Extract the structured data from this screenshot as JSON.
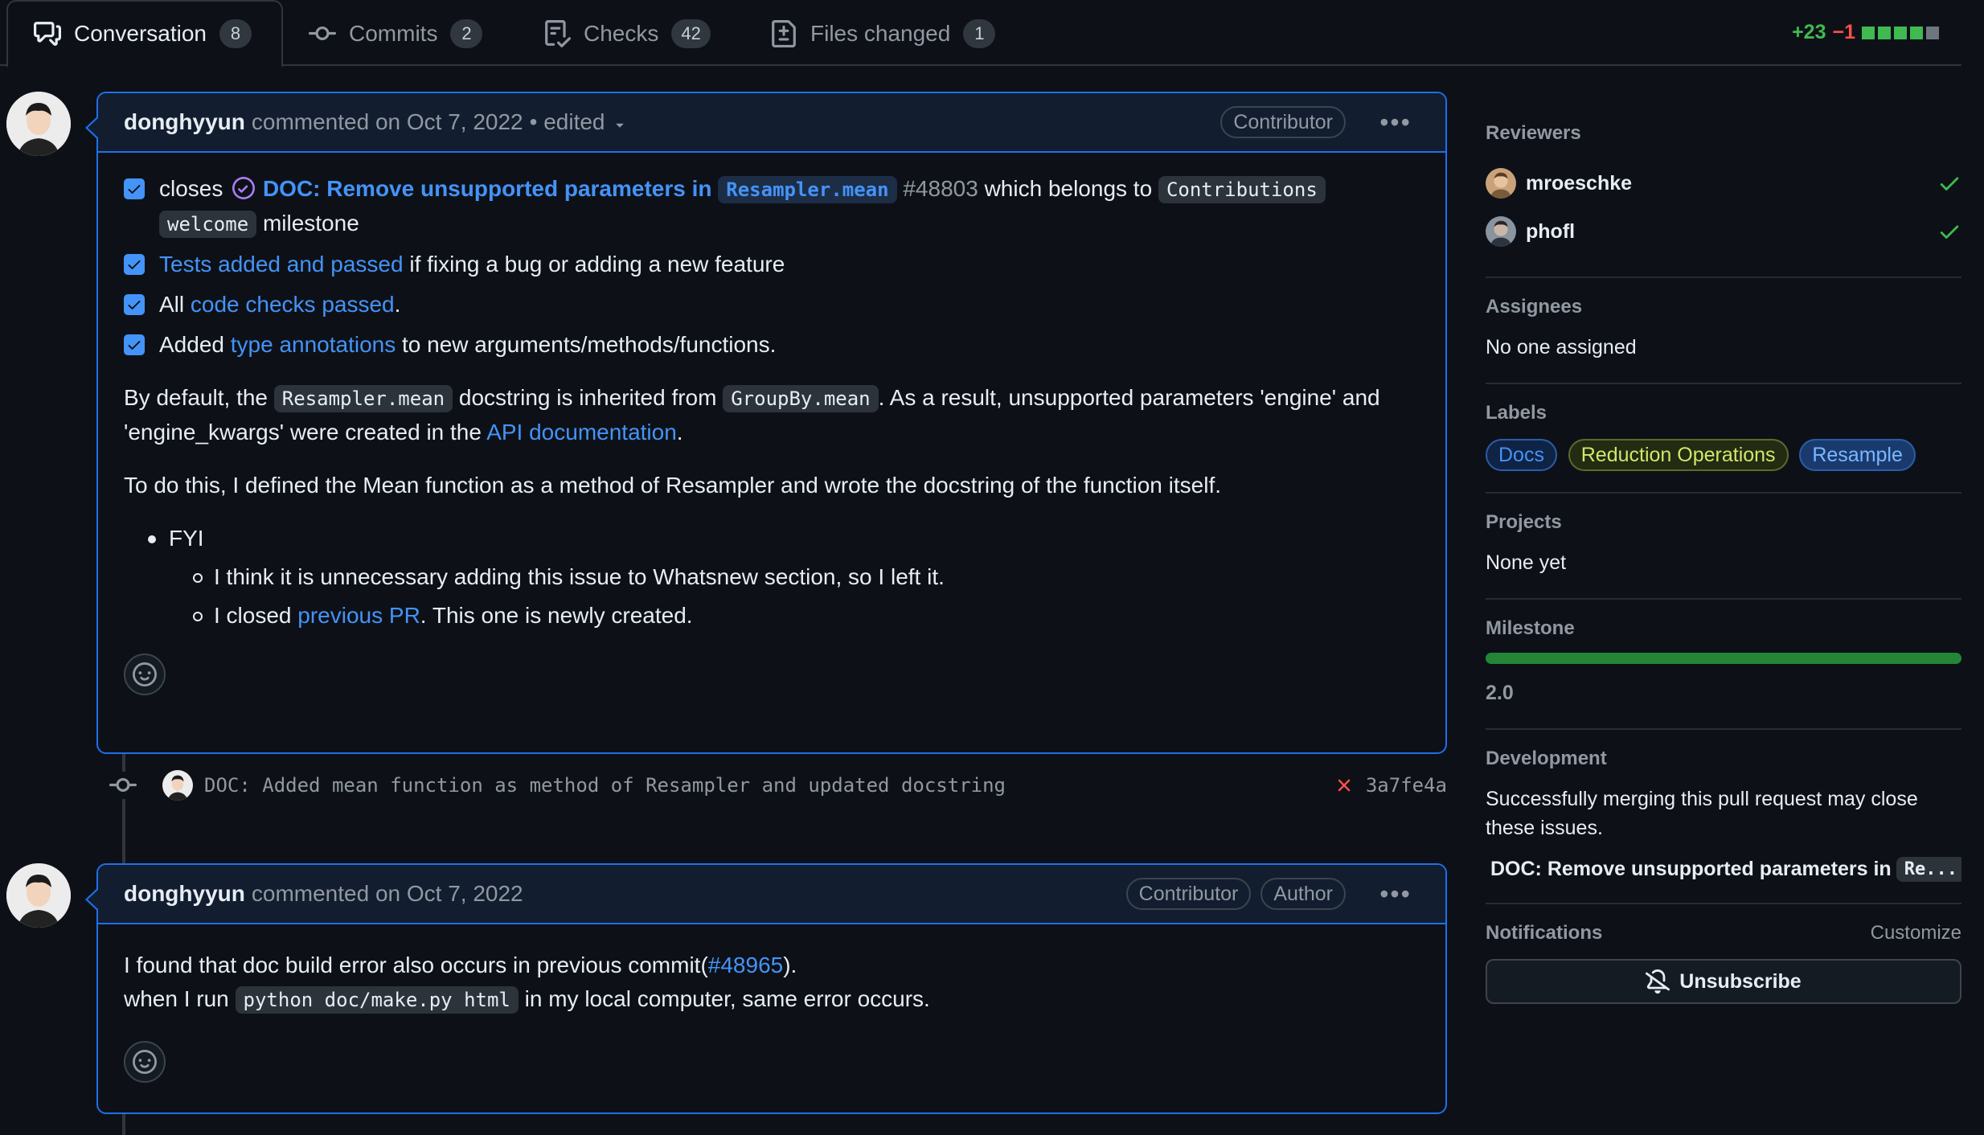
{
  "tabs": [
    {
      "label": "Conversation",
      "count": "8",
      "icon": "comment-discussion-icon"
    },
    {
      "label": "Commits",
      "count": "2",
      "icon": "git-commit-icon"
    },
    {
      "label": "Checks",
      "count": "42",
      "icon": "checklist-icon"
    },
    {
      "label": "Files changed",
      "count": "1",
      "icon": "file-diff-icon"
    }
  ],
  "diffstat": {
    "additions": "+23",
    "deletions": "−1"
  },
  "comment1": {
    "author": "donghyyun",
    "meta": "commented on Oct 7, 2022",
    "edited": "• edited",
    "badge": "Contributor",
    "task1": {
      "prefix": "closes",
      "issue_title": "DOC: Remove unsupported parameters in",
      "issue_code": "Resampler.mean",
      "issue_number": "#48803",
      "middle": "which belongs to",
      "milestone_code_1": "Contributions",
      "milestone_code_2": "welcome",
      "suffix": "milestone"
    },
    "task2": {
      "link": "Tests added and passed",
      "rest": "if fixing a bug or adding a new feature"
    },
    "task3": {
      "prefix": "All",
      "link": "code checks passed",
      "suffix": "."
    },
    "task4": {
      "prefix": "Added",
      "link": "type annotations",
      "suffix": "to new arguments/methods/functions."
    },
    "para1": {
      "p1": "By default, the",
      "code1": "Resampler.mean",
      "p2": "docstring is inherited from",
      "code2": "GroupBy.mean",
      "p3": ". As a result, unsupported parameters 'engine' and 'engine_kwargs' were created in the",
      "link": "API documentation",
      "p4": "."
    },
    "para2": "To do this, I defined the Mean function as a method of Resampler and wrote the docstring of the function itself.",
    "fyi": "FYI",
    "fyi_item1": "I think it is unnecessary adding this issue to Whatsnew section, so I left it.",
    "fyi_item2": {
      "prefix": "I closed",
      "link": "previous PR",
      "suffix": ". This one is newly created."
    }
  },
  "commit": {
    "message": "DOC: Added mean function as method of Resampler and updated docstring",
    "sha": "3a7fe4a",
    "status": "failed"
  },
  "comment2": {
    "author": "donghyyun",
    "meta": "commented on Oct 7, 2022",
    "badges": [
      "Contributor",
      "Author"
    ],
    "line1_prefix": "I found that doc build error also occurs in previous commit(",
    "line1_link": "#48965",
    "line1_suffix": ").",
    "line2_prefix": "when I run",
    "line2_code": "python doc/make.py html",
    "line2_suffix": "in my local computer, same error occurs."
  },
  "sidebar": {
    "reviewers": {
      "title": "Reviewers",
      "items": [
        {
          "name": "mroeschke",
          "status": "approved"
        },
        {
          "name": "phofl",
          "status": "approved"
        }
      ]
    },
    "assignees": {
      "title": "Assignees",
      "value": "No one assigned"
    },
    "labels": {
      "title": "Labels",
      "items": [
        {
          "name": "Docs",
          "color": "#4493f8"
        },
        {
          "name": "Reduction Operations",
          "color": "#d2e76b"
        },
        {
          "name": "Resample",
          "color": "#4493f8"
        }
      ]
    },
    "projects": {
      "title": "Projects",
      "value": "None yet"
    },
    "milestone": {
      "title": "Milestone",
      "value": "2.0",
      "progress": 1.0
    },
    "development": {
      "title": "Development",
      "text": "Successfully merging this pull request may close these issues.",
      "issue_title": "DOC: Remove unsupported parameters in",
      "issue_code": "Re..."
    },
    "notifications": {
      "title": "Notifications",
      "customize": "Customize",
      "button": "Unsubscribe"
    }
  },
  "colors": {
    "accent": "#1f6feb",
    "link": "#4493f8",
    "success": "#3fb950",
    "danger": "#f85149",
    "done": "#ab7df8"
  }
}
